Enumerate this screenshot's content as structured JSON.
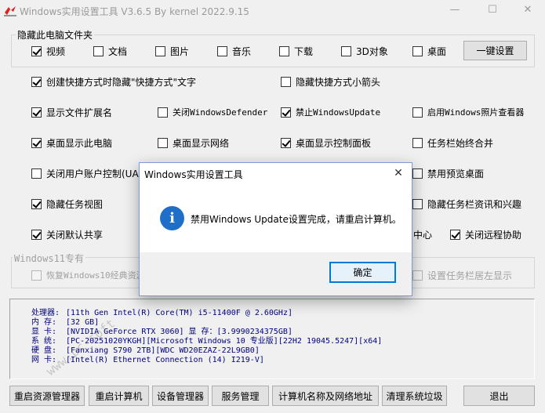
{
  "window": {
    "title": "Windows实用设置工具 V3.6.5 By kernel 2022.9.15",
    "minimize": "—",
    "maximize": "☐",
    "close": "✕"
  },
  "hide_folders": {
    "label": "隐藏此电脑文件夹",
    "items": [
      {
        "label": "视频",
        "checked": true
      },
      {
        "label": "文档",
        "checked": false
      },
      {
        "label": "图片",
        "checked": false
      },
      {
        "label": "音乐",
        "checked": false
      },
      {
        "label": "下载",
        "checked": false
      },
      {
        "label": "3D对象",
        "checked": false
      },
      {
        "label": "桌面",
        "checked": false
      }
    ],
    "button": "一键设置"
  },
  "options": [
    {
      "label": "创建快捷方式时隐藏\"快捷方式\"文字",
      "checked": true
    },
    {
      "label": "隐藏快捷方式小箭头",
      "checked": false
    },
    {
      "label": "显示文件扩展名",
      "checked": true
    },
    {
      "label": "关闭WindowsDefender",
      "checked": false
    },
    {
      "label": "禁止WindowsUpdate",
      "checked": true
    },
    {
      "label": "启用Windows照片查看器",
      "checked": false
    },
    {
      "label": "桌面显示此电脑",
      "checked": true
    },
    {
      "label": "桌面显示网络",
      "checked": false
    },
    {
      "label": "桌面显示控制面板",
      "checked": true
    },
    {
      "label": "任务栏始终合并",
      "checked": false
    },
    {
      "label": "关闭用户账户控制(UAC",
      "checked": false
    },
    {
      "label": "禁用预览桌面",
      "checked": false
    },
    {
      "label": "隐藏任务视图",
      "checked": true
    },
    {
      "label": "隐藏任务栏资讯和兴趣",
      "checked": false
    },
    {
      "label": "关闭默认共享",
      "checked": true
    },
    {
      "label": "中心",
      "checked": false
    },
    {
      "label": "关闭远程协助",
      "checked": true
    }
  ],
  "win11": {
    "label": "Windows11专有",
    "items": [
      {
        "label": "恢复Windows10经典资源",
        "checked": false
      },
      {
        "label": "设置任务栏居左显示",
        "checked": false
      }
    ]
  },
  "sysinfo": {
    "lines": [
      {
        "key": "处理器:",
        "value": "[11th Gen Intel(R) Core(TM) i5-11400F @ 2.60GHz]"
      },
      {
        "key": "内  存:",
        "value": "[32 GB]"
      },
      {
        "key": "显  卡:",
        "value": "[NVIDIA GeForce RTX 3060]  显 存：[3.9990234375GB]"
      },
      {
        "key": "系  统:",
        "value": "[PC-20251020YKGH][Microsoft Windows 10 专业版][22H2 19045.5247][x64]"
      },
      {
        "key": "硬  盘:",
        "value": "[Fanxiang S790 2TB][WDC WD20EZAZ-22L9GB0]"
      },
      {
        "key": "网  卡:",
        "value": "[Intel(R) Ethernet Connection (14) I219-V]"
      }
    ],
    "watermark": "www.pc-soft"
  },
  "buttons": [
    "重启资源管理器",
    "重启计算机",
    "设备管理器",
    "服务管理",
    "计算机名称及网络地址",
    "清理系统垃圾",
    "退出"
  ],
  "dialog": {
    "title": "Windows实用设置工具",
    "message": "禁用Windows Update设置完成，请重启计算机。",
    "icon": "i",
    "ok": "确定",
    "close": "✕"
  }
}
